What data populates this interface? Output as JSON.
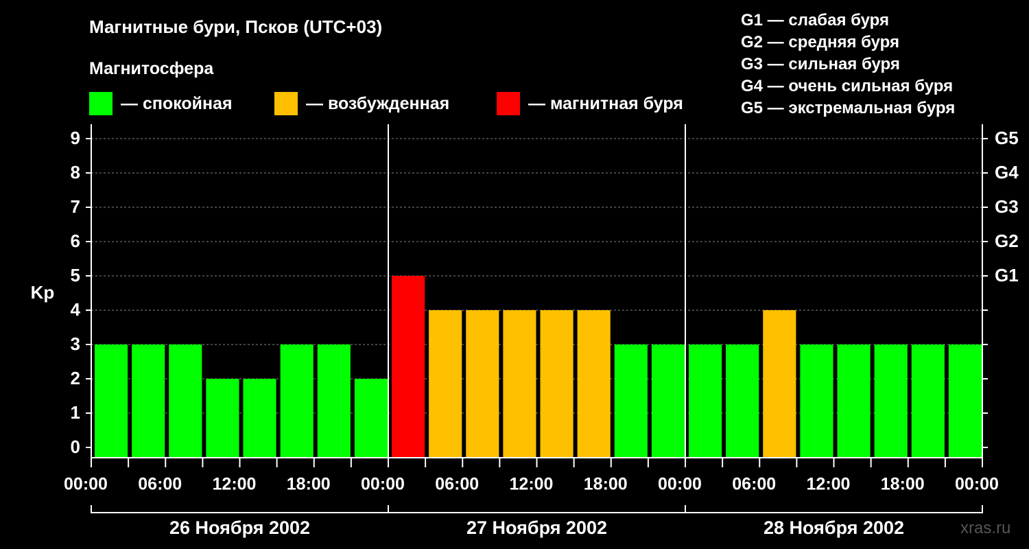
{
  "title": "Магнитные бури, Псков (UTC+03)",
  "subtitle": "Магнитосфера",
  "legend": [
    {
      "label": "— спокойная",
      "color": "#00ff00"
    },
    {
      "label": "— возбужденная",
      "color": "#ffc000"
    },
    {
      "label": "— магнитная буря",
      "color": "#ff0000"
    }
  ],
  "g_scale": [
    "G1 — слабая буря",
    "G2 — средняя буря",
    "G3 — сильная буря",
    "G4 — очень сильная буря",
    "G5 — экстремальная буря"
  ],
  "watermark": "xras.ru",
  "colors": {
    "calm": "#00ff00",
    "disturbed": "#ffc000",
    "storm": "#ff0000",
    "background": "#000000",
    "grid": "#888888"
  },
  "chart_data": {
    "type": "bar",
    "ylabel": "Kp",
    "ylim": [
      0,
      9
    ],
    "yticks": [
      "0",
      "1",
      "2",
      "3",
      "4",
      "5",
      "6",
      "7",
      "8",
      "9"
    ],
    "right_axis": [
      {
        "kp": 5,
        "label": "G1"
      },
      {
        "kp": 6,
        "label": "G2"
      },
      {
        "kp": 7,
        "label": "G3"
      },
      {
        "kp": 8,
        "label": "G4"
      },
      {
        "kp": 9,
        "label": "G5"
      }
    ],
    "xtick_labels": [
      "00:00",
      "06:00",
      "12:00",
      "18:00",
      "00:00",
      "06:00",
      "12:00",
      "18:00",
      "00:00",
      "06:00",
      "12:00",
      "18:00",
      "00:00"
    ],
    "days": [
      "26 Ноября 2002",
      "27 Ноября 2002",
      "28 Ноября 2002"
    ],
    "interval_hours": 3,
    "values": [
      3,
      3,
      3,
      2,
      2,
      3,
      3,
      2,
      5,
      4,
      4,
      4,
      4,
      4,
      3,
      3,
      3,
      3,
      4,
      3,
      3,
      3,
      3,
      3
    ],
    "grid": "horizontal dashed"
  }
}
